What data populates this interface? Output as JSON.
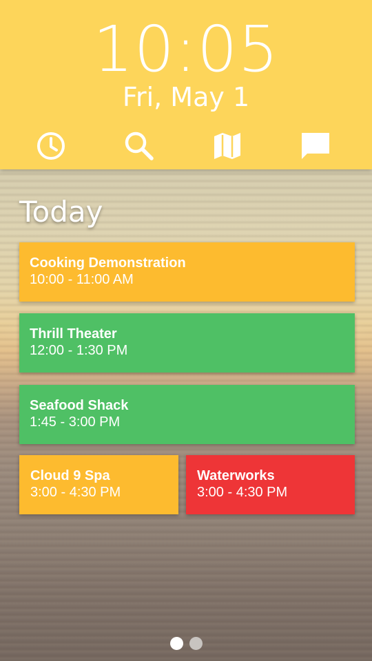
{
  "header": {
    "time": "10:05",
    "date": "Fri, May 1",
    "color": "#fdd55a",
    "toolbar": [
      {
        "icon": "clock-icon"
      },
      {
        "icon": "search-icon"
      },
      {
        "icon": "map-icon"
      },
      {
        "icon": "chat-icon"
      }
    ]
  },
  "agenda": {
    "heading": "Today",
    "events": [
      {
        "title": "Cooking Demonstration",
        "time": "10:00 - 11:00 AM",
        "color": "#fdbb2f"
      },
      {
        "title": "Thrill Theater",
        "time": "12:00 - 1:30 PM",
        "color": "#4fc065"
      },
      {
        "title": "Seafood Shack",
        "time": "1:45 - 3:00 PM",
        "color": "#4fc065"
      },
      {
        "title": "Cloud 9 Spa",
        "time": "3:00 - 4:30 PM",
        "color": "#fdbb2f"
      },
      {
        "title": "Waterworks",
        "time": "3:00 - 4:30 PM",
        "color": "#ee3537"
      }
    ]
  },
  "pager": {
    "pages": 2,
    "current": 1,
    "active_color": "#ffffff",
    "inactive_color": "#c8c4c0"
  }
}
